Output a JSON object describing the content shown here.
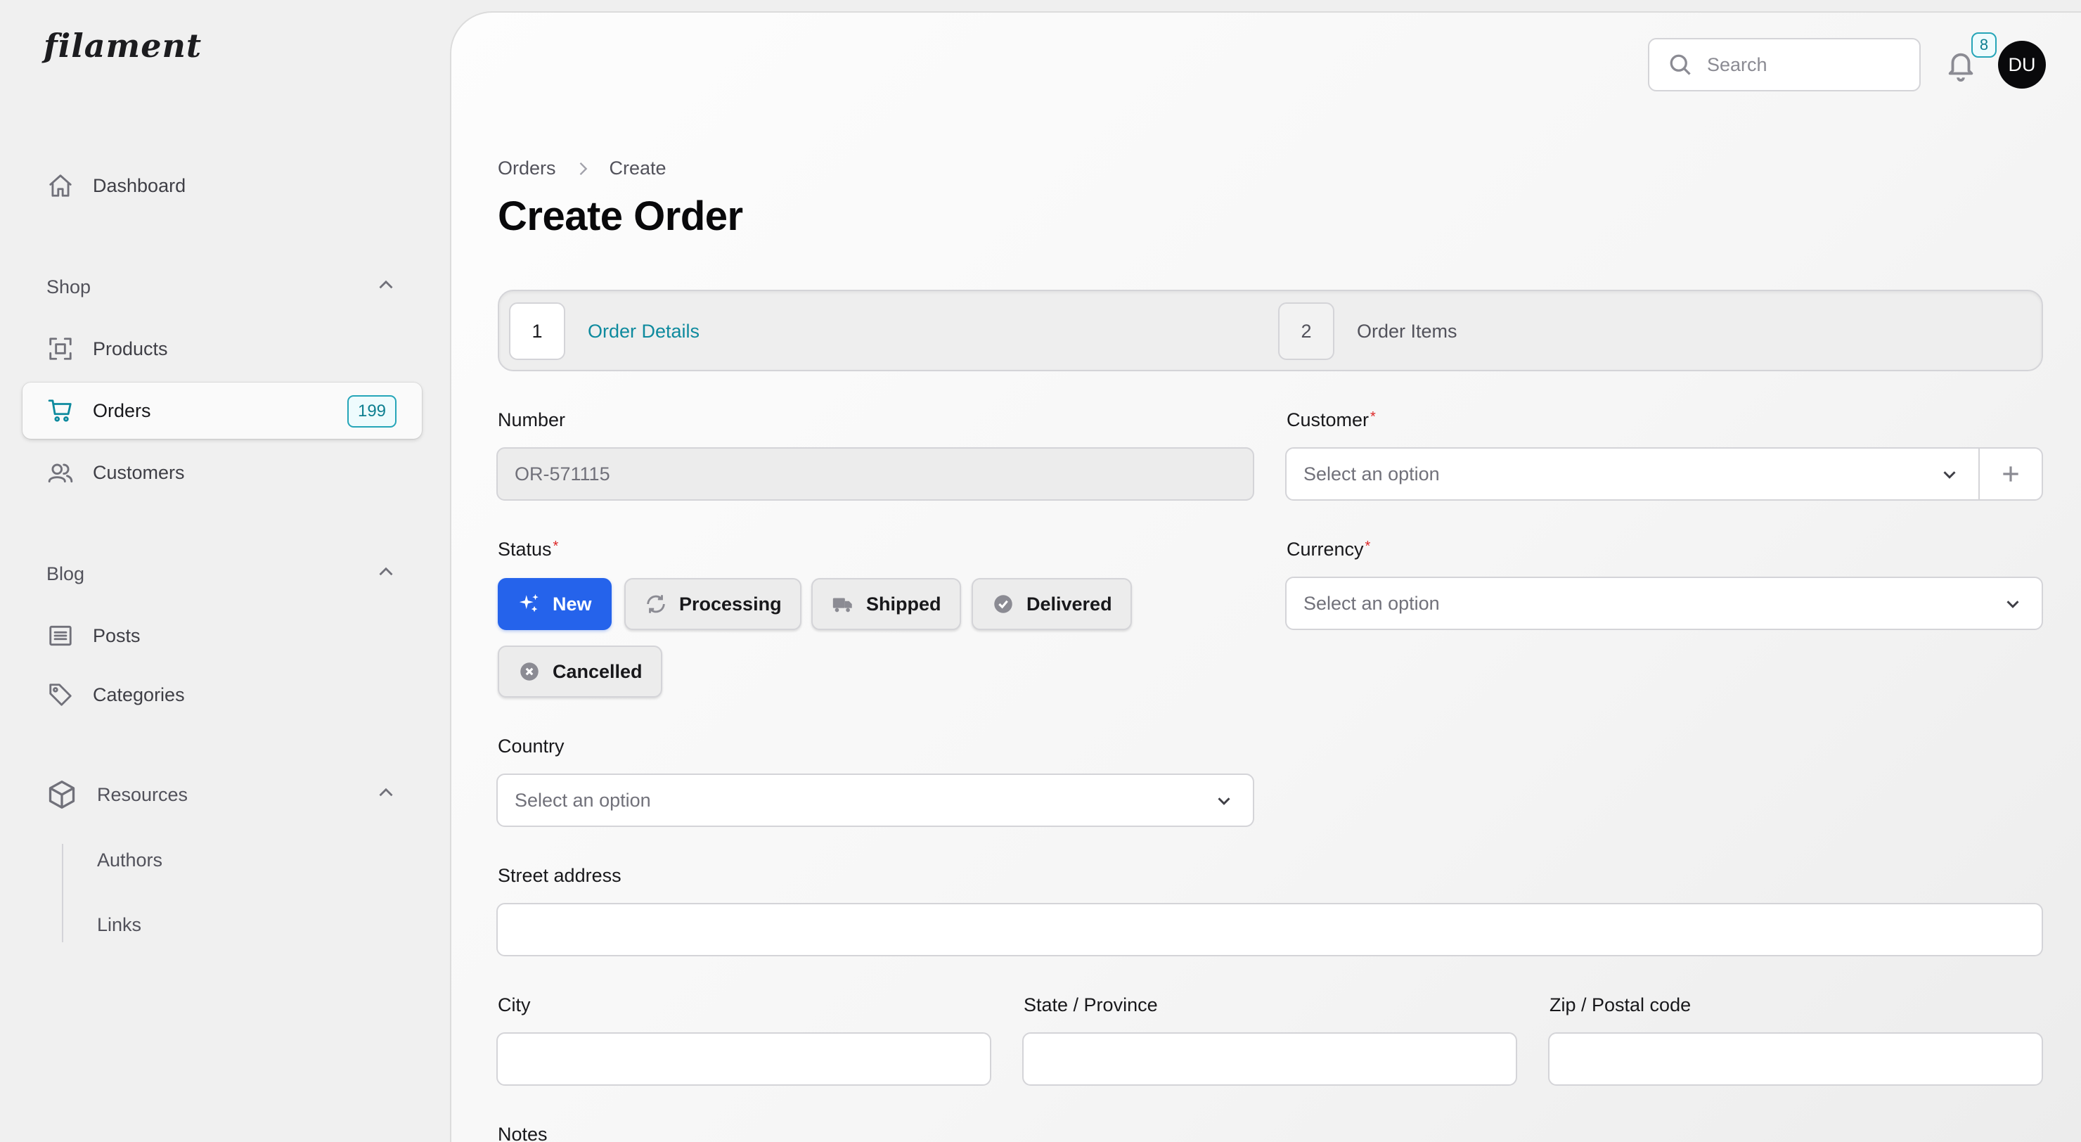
{
  "app": {
    "logo": "filament"
  },
  "sidebar": {
    "dashboard": "Dashboard",
    "groups": {
      "shop": "Shop",
      "blog": "Blog",
      "resources": "Resources"
    },
    "items": {
      "products": "Products",
      "orders": "Orders",
      "orders_badge": "199",
      "customers": "Customers",
      "posts": "Posts",
      "categories": "Categories",
      "authors": "Authors",
      "links": "Links"
    },
    "active": "Orders"
  },
  "topbar": {
    "search_placeholder": "Search",
    "notifications_count": "8",
    "avatar_initials": "DU"
  },
  "breadcrumb": [
    "Orders",
    "Create"
  ],
  "page_title": "Create Order",
  "wizard": {
    "steps": [
      {
        "number": "1",
        "label": "Order Details",
        "active": true
      },
      {
        "number": "2",
        "label": "Order Items",
        "active": false
      }
    ]
  },
  "form": {
    "number": {
      "label": "Number",
      "value": "OR-571115"
    },
    "customer": {
      "label": "Customer",
      "placeholder": "Select an option"
    },
    "status": {
      "label": "Status",
      "options": [
        "New",
        "Processing",
        "Shipped",
        "Delivered",
        "Cancelled"
      ],
      "selected": "New"
    },
    "currency": {
      "label": "Currency",
      "placeholder": "Select an option"
    },
    "country": {
      "label": "Country",
      "placeholder": "Select an option"
    },
    "street": {
      "label": "Street address",
      "value": ""
    },
    "city": {
      "label": "City",
      "value": ""
    },
    "state": {
      "label": "State / Province",
      "value": ""
    },
    "zip": {
      "label": "Zip / Postal code",
      "value": ""
    },
    "notes": {
      "label": "Notes"
    }
  },
  "colors": {
    "accent": "#0e8a9e",
    "primary": "#2563eb",
    "required": "#dc2626"
  }
}
